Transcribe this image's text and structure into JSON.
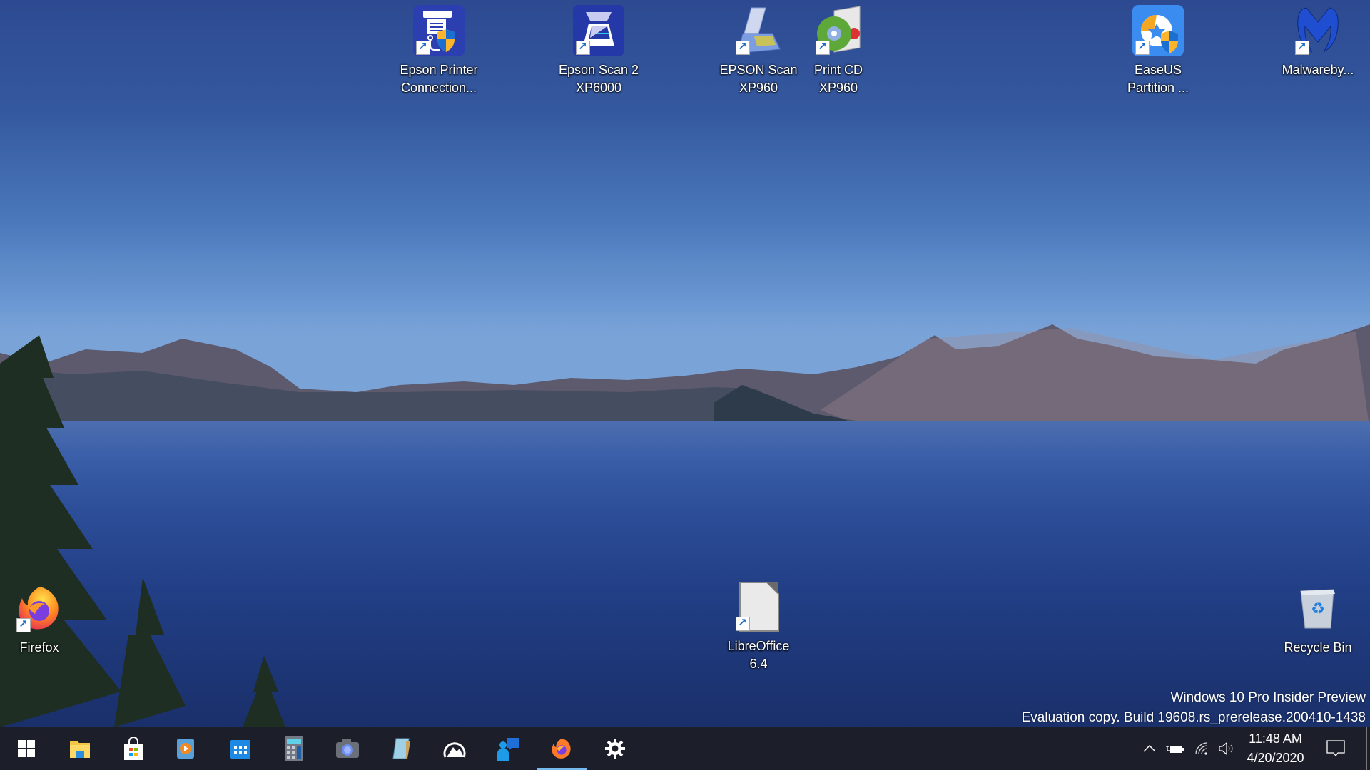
{
  "desktop": {
    "icons": [
      {
        "name": "epson-printer-connection",
        "label_line1": "Epson Printer",
        "label_line2": "Connection...",
        "shortcut": true
      },
      {
        "name": "epson-scan-2",
        "label_line1": "Epson Scan 2",
        "label_line2": "XP6000",
        "shortcut": true
      },
      {
        "name": "epson-scan-xp960",
        "label_line1": "EPSON Scan",
        "label_line2": "XP960",
        "shortcut": true
      },
      {
        "name": "print-cd-xp960",
        "label_line1": "Print CD",
        "label_line2": "XP960",
        "shortcut": true
      },
      {
        "name": "easeus-partition",
        "label_line1": "EaseUS",
        "label_line2": "Partition ...",
        "shortcut": true
      },
      {
        "name": "malwarebytes",
        "label_line1": "Malwareby...",
        "label_line2": "",
        "shortcut": true
      },
      {
        "name": "firefox",
        "label_line1": "Firefox",
        "label_line2": "",
        "shortcut": true
      },
      {
        "name": "libreoffice",
        "label_line1": "LibreOffice",
        "label_line2": "6.4",
        "shortcut": true
      },
      {
        "name": "recycle-bin",
        "label_line1": "Recycle Bin",
        "label_line2": "",
        "shortcut": false
      }
    ],
    "watermark": {
      "line1": "Windows 10 Pro Insider Preview",
      "line2": "Evaluation copy. Build 19608.rs_prerelease.200410-1438"
    }
  },
  "taskbar": {
    "apps": [
      {
        "name": "start",
        "icon": "windows-logo-icon"
      },
      {
        "name": "file-explorer",
        "icon": "folder-icon"
      },
      {
        "name": "microsoft-store",
        "icon": "store-bag-icon"
      },
      {
        "name": "media-player",
        "icon": "media-play-icon"
      },
      {
        "name": "calendar",
        "icon": "calendar-icon"
      },
      {
        "name": "calculator",
        "icon": "calculator-icon"
      },
      {
        "name": "camera",
        "icon": "camera-icon"
      },
      {
        "name": "notepad",
        "icon": "notepad-icon"
      },
      {
        "name": "photos",
        "icon": "photos-icon"
      },
      {
        "name": "feedback-hub",
        "icon": "feedback-icon"
      },
      {
        "name": "firefox",
        "icon": "firefox-icon",
        "active": true
      },
      {
        "name": "settings",
        "icon": "gear-icon"
      }
    ],
    "tray": {
      "show_hidden_icon": "chevron-up-icon",
      "battery_icon": "battery-charging-icon",
      "network_icon": "wifi-icon",
      "volume_icon": "volume-icon",
      "time": "11:48 AM",
      "date": "4/20/2020",
      "notifications_icon": "action-center-icon"
    },
    "accent_color": "#76b9ed",
    "background_color": "#1c1f2a"
  }
}
